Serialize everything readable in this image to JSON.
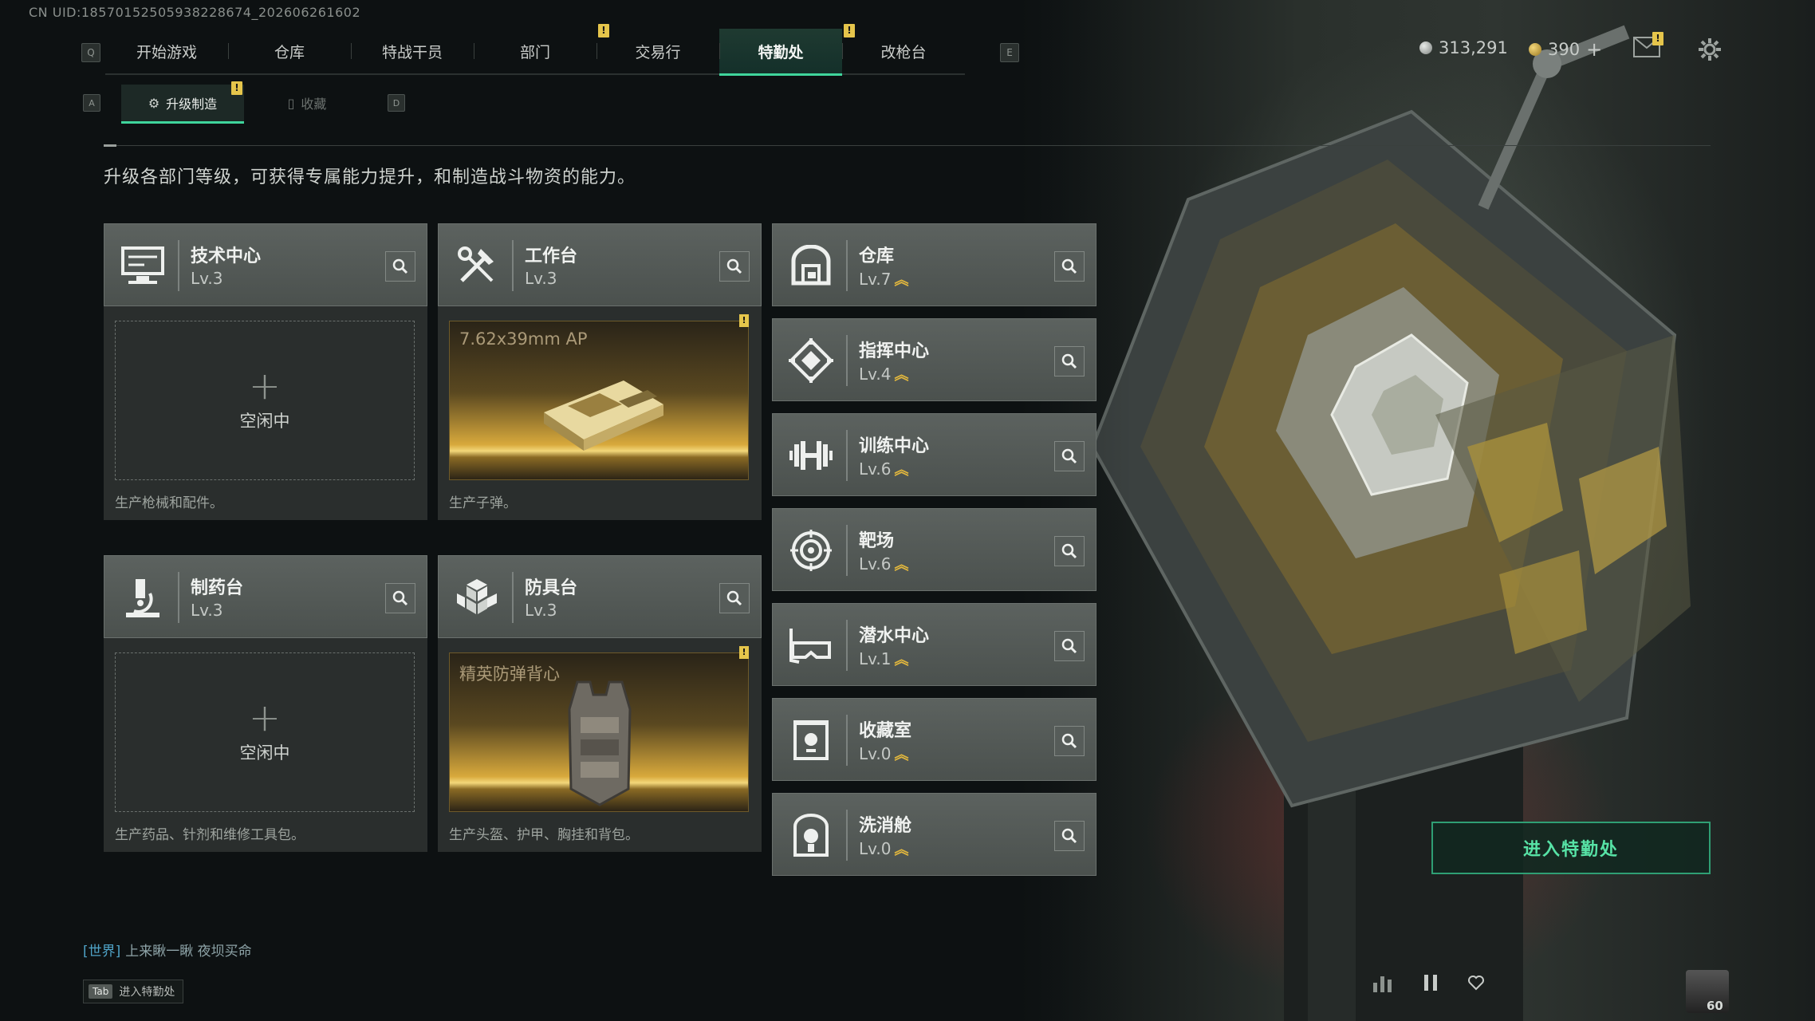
{
  "uid": "CN UID:18570152505938228674_202606261602",
  "nav": {
    "left_key": "Q",
    "right_key": "E",
    "tabs": [
      {
        "label": "开始游戏"
      },
      {
        "label": "仓库"
      },
      {
        "label": "特战干员"
      },
      {
        "label": "部门"
      },
      {
        "label": "交易行"
      },
      {
        "label": "特勤处",
        "active": true
      },
      {
        "label": "改枪台"
      }
    ]
  },
  "currency": {
    "silver": "313,291",
    "gold": "390",
    "gold_add": "+"
  },
  "subnav": {
    "left_key": "A",
    "right_key": "D",
    "tabs": [
      {
        "label": "升级制造",
        "active": true
      },
      {
        "label": "收藏"
      }
    ]
  },
  "badge_mark": "!",
  "description": "升级各部门等级，可获得专属能力提升，和制造战斗物资的能力。",
  "workshops": [
    {
      "name": "技术中心",
      "level": "Lv.3",
      "icon": "monitor-icon",
      "state": "idle",
      "idle_text": "空闲中",
      "idle_plus": "+",
      "desc": "生产枪械和配件。"
    },
    {
      "name": "工作台",
      "level": "Lv.3",
      "icon": "tools-icon",
      "state": "producing",
      "product": "7.62x39mm AP",
      "desc": "生产子弹。"
    },
    {
      "name": "制药台",
      "level": "Lv.3",
      "icon": "microscope-icon",
      "state": "idle",
      "idle_text": "空闲中",
      "idle_plus": "+",
      "desc": "生产药品、针剂和维修工具包。"
    },
    {
      "name": "防具台",
      "level": "Lv.3",
      "icon": "cubes-icon",
      "state": "producing",
      "product": "精英防弹背心",
      "desc": "生产头盔、护甲、胸挂和背包。"
    }
  ],
  "departments": [
    {
      "name": "仓库",
      "level": "Lv.7",
      "icon": "warehouse-icon"
    },
    {
      "name": "指挥中心",
      "level": "Lv.4",
      "icon": "command-icon"
    },
    {
      "name": "训练中心",
      "level": "Lv.6",
      "icon": "dumbbell-icon"
    },
    {
      "name": "靶场",
      "level": "Lv.6",
      "icon": "target-icon"
    },
    {
      "name": "潜水中心",
      "level": "Lv.1",
      "icon": "diving-mask-icon"
    },
    {
      "name": "收藏室",
      "level": "Lv.0",
      "icon": "collection-icon"
    },
    {
      "name": "洗消舱",
      "level": "Lv.0",
      "icon": "decon-icon"
    }
  ],
  "upgrade_glyph": "︽",
  "enter_button": "进入特勤处",
  "chat": {
    "channel": "[世界]",
    "message": "上来瞅一瞅  夜坝买命"
  },
  "tab_hint": {
    "key": "Tab",
    "label": "进入特勤处"
  },
  "fps": "60",
  "colors": {
    "accent": "#3fd59c",
    "warning": "#e5c54b",
    "upgrade": "#e2b73d"
  }
}
